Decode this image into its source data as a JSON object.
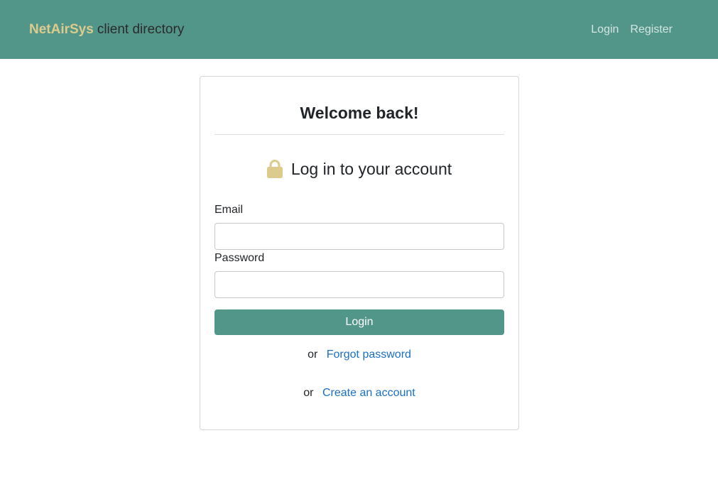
{
  "navbar": {
    "brand_strong": "NetAirSys",
    "brand_rest": "client directory",
    "links": [
      "Login",
      "Register"
    ]
  },
  "card": {
    "welcome": "Welcome back!",
    "subheading": "Log in to your account",
    "lock_icon": "lock-icon",
    "email_label": "Email",
    "email_value": "",
    "password_label": "Password",
    "password_value": "",
    "login_button": "Login",
    "or_word": "or",
    "forgot_link": "Forgot password",
    "create_link": "Create an account"
  },
  "colors": {
    "accent": "#52968a",
    "brand_highlight": "#dccb8c",
    "lock": "#dccb8c",
    "link": "#1a6fc4"
  }
}
